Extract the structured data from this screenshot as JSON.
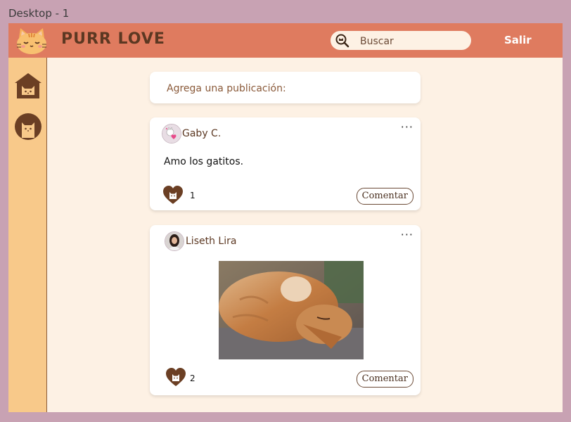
{
  "frame": {
    "label": "Desktop - 1"
  },
  "header": {
    "brand": "PURR LOVE",
    "search_placeholder": "Buscar",
    "logout_label": "Salir"
  },
  "colors": {
    "header": "#df7b5f",
    "sidebar": "#f8c98a",
    "background": "#fdf1e4",
    "brown": "#5c3822"
  },
  "sidebar": {
    "items": [
      {
        "icon": "cat-house-icon"
      },
      {
        "icon": "cat-face-icon"
      }
    ]
  },
  "composer": {
    "placeholder": "Agrega una publicación:"
  },
  "posts": [
    {
      "author": "Gaby C.",
      "text": "Amo los gatitos.",
      "likes": "1",
      "comment_label": "Comentar"
    },
    {
      "author": "Liseth Lira",
      "likes": "2",
      "comment_label": "Comentar"
    }
  ]
}
